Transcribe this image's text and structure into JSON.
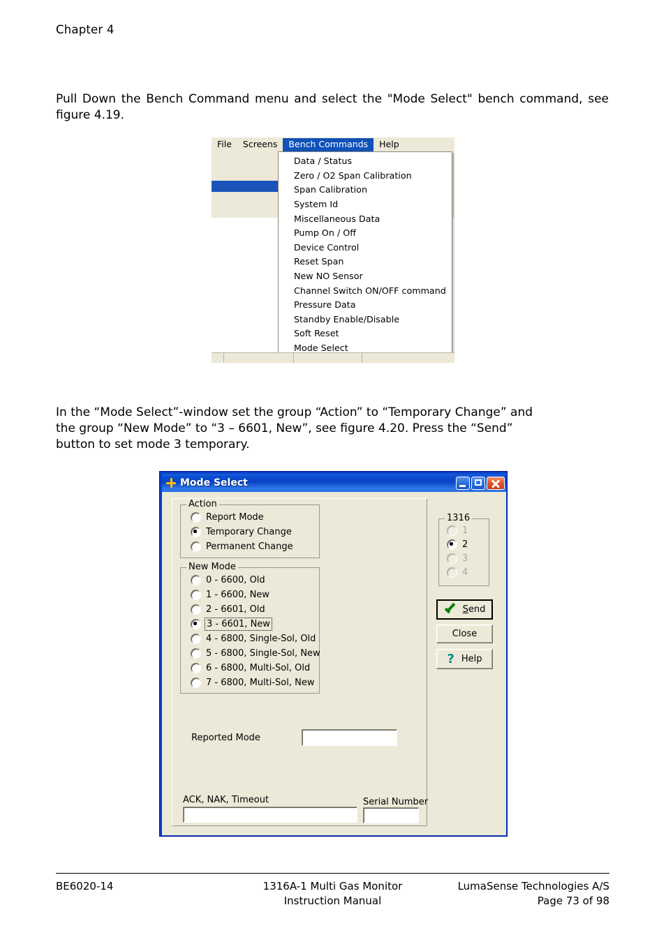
{
  "page": {
    "chapter": "Chapter 4",
    "paragraph_1": "Pull Down the Bench Command menu and select the \"Mode Select\" bench command, see figure 4.19.",
    "paragraph_2_line1": "In the “Mode Select”-window set the group “Action” to “Temporary Change” and",
    "paragraph_2_line2": "the group “New Mode” to “3 – 6601, New”, see figure 4.20. Press the “Send”",
    "paragraph_2_line3": "button to set mode 3 temporary."
  },
  "menu_figure": {
    "menubar": [
      {
        "label": "File",
        "active": false
      },
      {
        "label": "Screens",
        "active": false
      },
      {
        "label": "Bench Commands",
        "active": true
      },
      {
        "label": "Help",
        "active": false
      }
    ],
    "dropdown_items": [
      "Data / Status",
      "Zero / O2 Span Calibration",
      "Span Calibration",
      "System Id",
      "Miscellaneous Data",
      "Pump On / Off",
      "Device Control",
      "Reset Span",
      "New NO Sensor",
      "Channel Switch ON/OFF command",
      "Pressure Data",
      "Standby Enable/Disable",
      "Soft Reset",
      "Mode Select"
    ],
    "highlight_color": "#1a53ba",
    "menubar_active_color": "#1052b8",
    "chrome_color": "#ece9d8"
  },
  "dialog": {
    "title": "Mode Select",
    "title_icon": "plus-star-icon",
    "titlebar_color": "#0b4fd3",
    "window_buttons": [
      {
        "name": "minimize-button",
        "glyph": "minimize-icon"
      },
      {
        "name": "maximize-button",
        "glyph": "maximize-icon"
      },
      {
        "name": "close-button",
        "glyph": "close-icon"
      }
    ],
    "action_group": {
      "title": "Action",
      "options": [
        {
          "label": "Report Mode",
          "checked": false,
          "enabled": true
        },
        {
          "label": "Temporary Change",
          "checked": true,
          "enabled": true
        },
        {
          "label": "Permanent Change",
          "checked": false,
          "enabled": true
        }
      ]
    },
    "new_mode_group": {
      "title": "New Mode",
      "options": [
        {
          "label": "0 - 6600, Old",
          "checked": false,
          "focused": false
        },
        {
          "label": "1 - 6600, New",
          "checked": false,
          "focused": false
        },
        {
          "label": "2 - 6601, Old",
          "checked": false,
          "focused": false
        },
        {
          "label": "3 - 6601, New",
          "checked": true,
          "focused": true
        },
        {
          "label": "4 - 6800, Single-Sol, Old",
          "checked": false,
          "focused": false
        },
        {
          "label": "5 - 6800, Single-Sol, New",
          "checked": false,
          "focused": false
        },
        {
          "label": "6 - 6800, Multi-Sol, Old",
          "checked": false,
          "focused": false
        },
        {
          "label": "7 - 6800, Multi-Sol, New",
          "checked": false,
          "focused": false
        }
      ]
    },
    "device_group": {
      "title": "1316",
      "options": [
        {
          "label": "1",
          "checked": false,
          "enabled": false
        },
        {
          "label": "2",
          "checked": true,
          "enabled": true
        },
        {
          "label": "3",
          "checked": false,
          "enabled": false
        },
        {
          "label": "4",
          "checked": false,
          "enabled": false
        }
      ]
    },
    "fields": {
      "reported_mode_label": "Reported Mode",
      "reported_mode_value": "",
      "ack_label": "ACK, NAK, Timeout",
      "ack_value": "",
      "serial_label": "Serial Number",
      "serial_value": ""
    },
    "buttons": {
      "send_prefix": "S",
      "send_rest": "end",
      "close": "Close",
      "help": "Help"
    }
  },
  "footer": {
    "left_line1": "BE6020-14",
    "center_line1": "1316A-1 Multi Gas Monitor",
    "center_line2": "Instruction Manual",
    "right_line1": "LumaSense Technologies A/S",
    "right_line2": "Page 73 of 98"
  }
}
